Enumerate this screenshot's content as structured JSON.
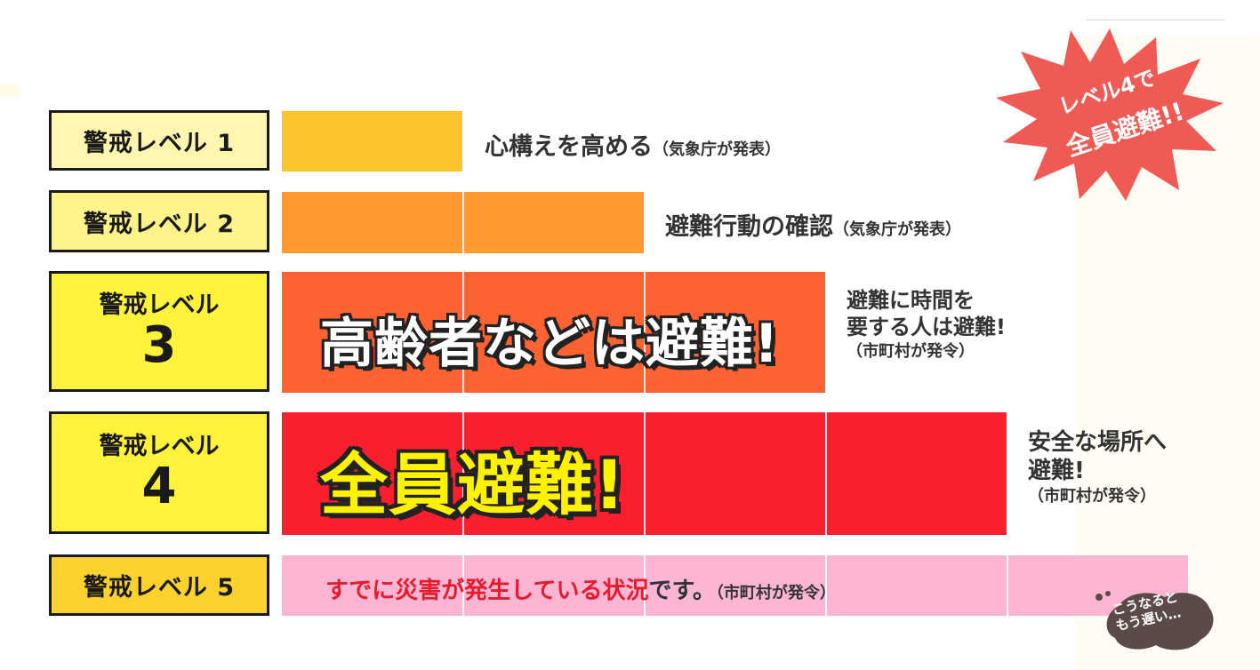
{
  "levels": [
    {
      "label": "警戒レベル 1",
      "desc_main": "心構えを高める",
      "desc_sub": "（気象庁が発表）",
      "color": "#fcc42f"
    },
    {
      "label": "警戒レベル 2",
      "desc_main": "避難行動の確認",
      "desc_sub": "（気象庁が発表）",
      "color": "#ff9a2f"
    },
    {
      "label_top": "警戒レベル",
      "label_num": "3",
      "bar_text": "高齢者などは避難!",
      "desc_line1": "避難に時間を",
      "desc_line2": "要する人は避難!",
      "desc_sub": "（市町村が発令）",
      "color": "#ff6233"
    },
    {
      "label_top": "警戒レベル",
      "label_num": "4",
      "bar_text": "全員避難!",
      "desc_line1": "安全な場所へ",
      "desc_line2": "避難!",
      "desc_sub": "（市町村が発令）",
      "color": "#fb1f30"
    },
    {
      "label": "警戒レベル 5",
      "desc_accent1": "すでに災害が発生している状況",
      "desc_tail": "です。",
      "desc_sub": "（市町村が発令）",
      "color": "#fcb6d3"
    }
  ],
  "box_colors": {
    "l1": "#fff7b0",
    "l2": "#fff48a",
    "l3": "#fff23a",
    "l4": "#fff23a",
    "l5": "#fdd22e"
  },
  "starburst": {
    "line1": "レベル4で",
    "line2": "全員避難!!",
    "color": "#ef5a55"
  },
  "note_blob": {
    "line1": "こうなると",
    "line2": "もう遅い…",
    "color": "#5a4a48"
  }
}
